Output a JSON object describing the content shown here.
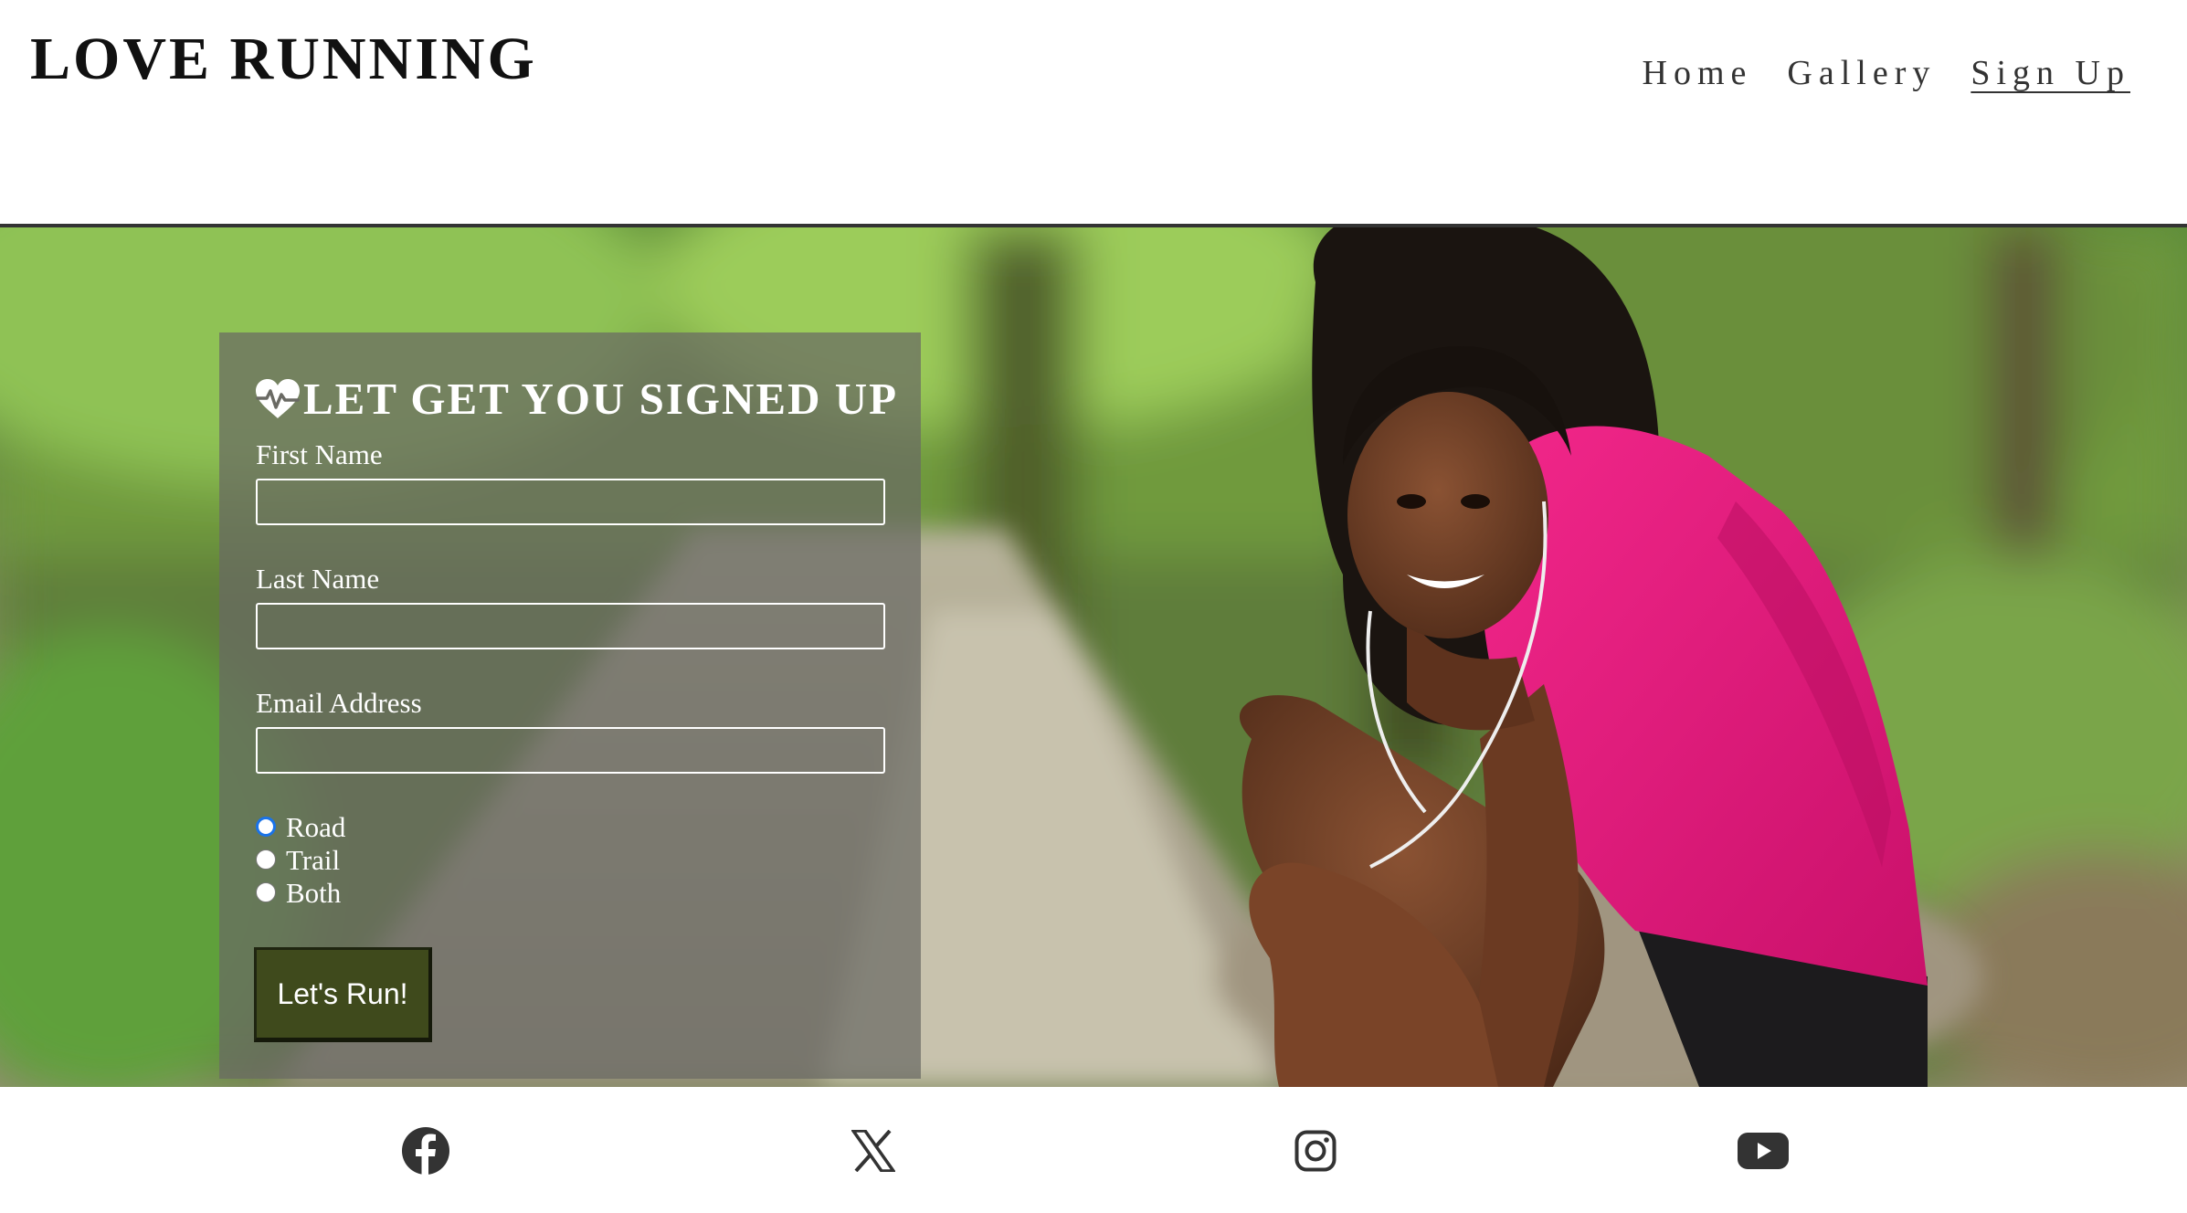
{
  "header": {
    "logo": "LOVE RUNNING",
    "nav": [
      {
        "label": "Home",
        "active": false
      },
      {
        "label": "Gallery",
        "active": false
      },
      {
        "label": "Sign Up",
        "active": true
      }
    ]
  },
  "form": {
    "title": "LET GET YOU SIGNED UP",
    "title_icon": "heartbeat-icon",
    "fields": [
      {
        "label": "First Name",
        "value": "",
        "placeholder": ""
      },
      {
        "label": "Last Name",
        "value": "",
        "placeholder": ""
      },
      {
        "label": "Email Address",
        "value": "",
        "placeholder": ""
      }
    ],
    "run_type_options": [
      {
        "label": "Road",
        "checked": true
      },
      {
        "label": "Trail",
        "checked": false
      },
      {
        "label": "Both",
        "checked": false
      }
    ],
    "submit_label": "Let's Run!"
  },
  "footer": {
    "social_icons": [
      "facebook-icon",
      "x-icon",
      "instagram-icon",
      "youtube-icon"
    ]
  },
  "colors": {
    "button_bg": "#3f4a1c",
    "radio_accent": "#1a73e8",
    "shirt_pink": "#e8187a",
    "text_dark": "#111111"
  }
}
